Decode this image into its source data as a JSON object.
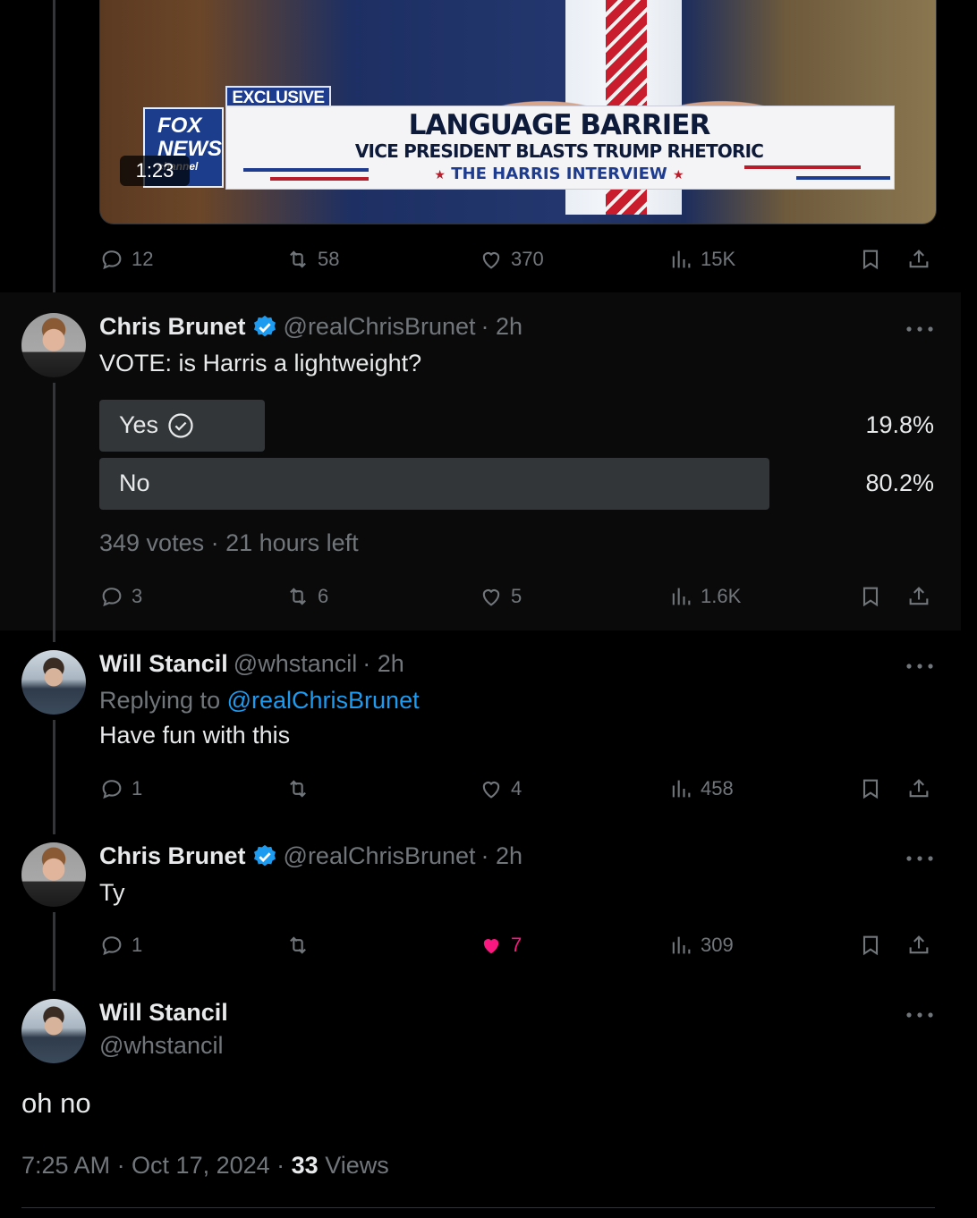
{
  "video": {
    "badge": "EXCLUSIVE",
    "headline": "LANGUAGE BARRIER",
    "subheadline": "VICE PRESIDENT BLASTS TRUMP RHETORIC",
    "show": "THE HARRIS INTERVIEW",
    "logo_line1": "FOX",
    "logo_line2": "NEWS",
    "logo_line3": "channel",
    "duration": "1:23"
  },
  "video_actions": {
    "replies": "12",
    "reposts": "58",
    "likes": "370",
    "views": "15K"
  },
  "poll_tweet": {
    "name": "Chris Brunet",
    "handle": "@realChrisBrunet",
    "time": "· 2h",
    "text": "VOTE: is Harris a lightweight?",
    "options": [
      {
        "label": "Yes",
        "percent": "19.8%",
        "value": 19.8,
        "chosen": true
      },
      {
        "label": "No",
        "percent": "80.2%",
        "value": 80.2,
        "chosen": false
      }
    ],
    "meta": "349 votes · 21 hours left",
    "actions": {
      "replies": "3",
      "reposts": "6",
      "likes": "5",
      "views": "1.6K"
    }
  },
  "reply1": {
    "name": "Will Stancil",
    "handle": "@whstancil",
    "time": "· 2h",
    "replying_prefix": "Replying to",
    "replying_to": "@realChrisBrunet",
    "text": "Have fun with this",
    "actions": {
      "replies": "1",
      "reposts": "",
      "likes": "4",
      "views": "458"
    }
  },
  "reply2": {
    "name": "Chris Brunet",
    "handle": "@realChrisBrunet",
    "time": "· 2h",
    "text": "Ty",
    "actions": {
      "replies": "1",
      "reposts": "",
      "likes": "7",
      "views": "309"
    },
    "liked": true
  },
  "main_tweet": {
    "name": "Will Stancil",
    "handle": "@whstancil",
    "text": "oh no",
    "timestamp": "7:25 AM · Oct 17, 2024 · ",
    "views_count": "33",
    "views_label": " Views"
  },
  "colors": {
    "background": "#000000",
    "text": "#e7e9ea",
    "muted": "#71767b",
    "link": "#1d9bf0",
    "like": "#f91880",
    "verified": "#1d9bf0",
    "poll_bar": "#333639"
  }
}
